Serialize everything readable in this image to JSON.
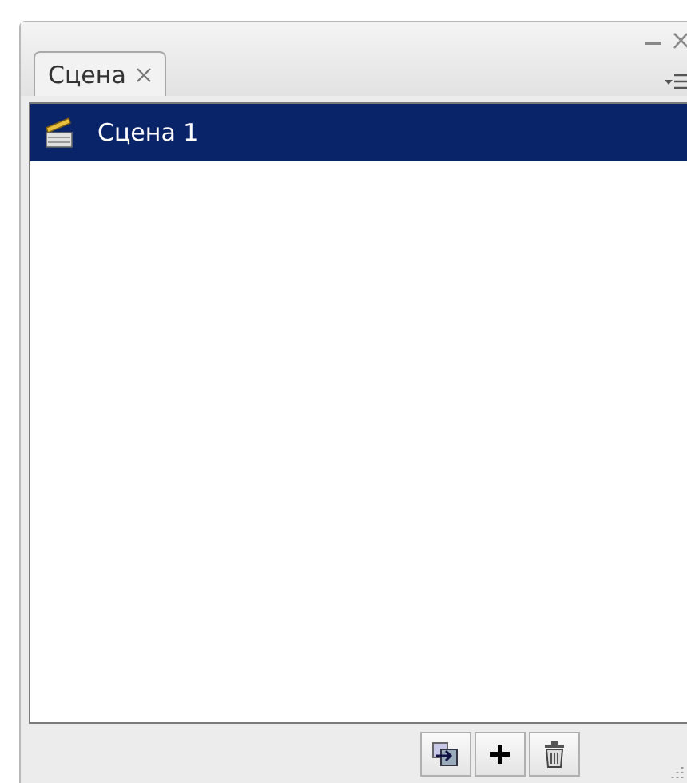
{
  "panel": {
    "tab": {
      "label": "Сцена",
      "selected": true
    }
  },
  "scenes": [
    {
      "name": "Сцена 1",
      "selected": true
    }
  ]
}
